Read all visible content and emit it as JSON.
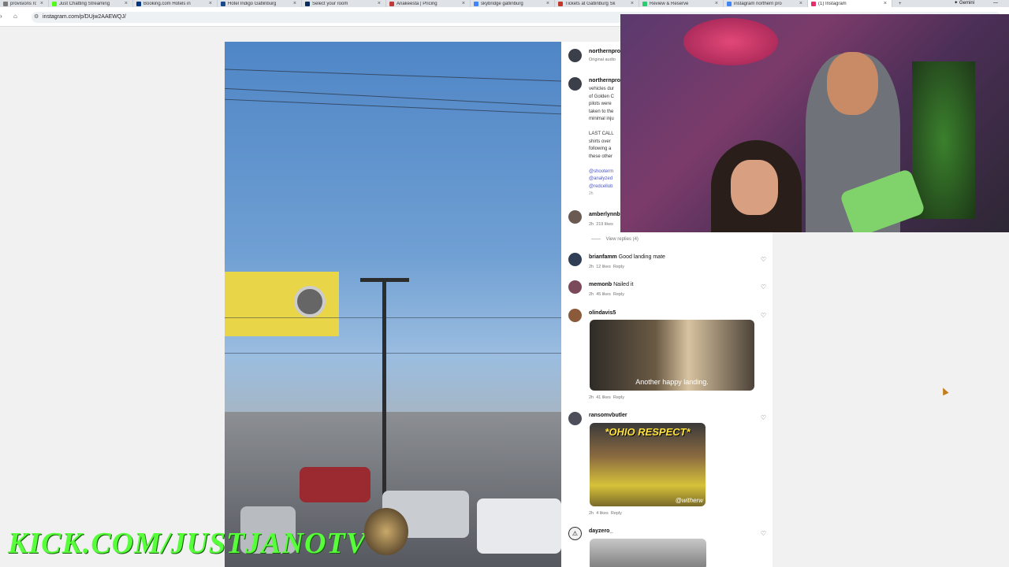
{
  "browser": {
    "tabs": [
      {
        "label": "provisions robi",
        "color": "#7a7a7a"
      },
      {
        "label": "Just Chatting Streaming",
        "color": "#53fc18"
      },
      {
        "label": "Booking.com Hotels in",
        "color": "#003580"
      },
      {
        "label": "Hotel Indigo Gatlinburg",
        "color": "#1a4a8a"
      },
      {
        "label": "Select your room",
        "color": "#0b2d5c"
      },
      {
        "label": "Anakeesta | Pricing",
        "color": "#c23b3b"
      },
      {
        "label": "skybridge gatlinburg",
        "color": "#4285f4"
      },
      {
        "label": "Tickets at Gatlinburg Sk",
        "color": "#c0392b"
      },
      {
        "label": "Review & Reserve",
        "color": "#2ecc71"
      },
      {
        "label": "instagram northern pro",
        "color": "#4285f4"
      },
      {
        "label": "(1) Instagram",
        "color": "#e1306c",
        "active": true
      }
    ],
    "gemini_label": "Gemini",
    "url": "instagram.com/p/DUjw2AAEWQJ/"
  },
  "post": {
    "header_user": "northernpro",
    "header_sub": "Original audio",
    "caption_user": "northernpro",
    "caption_lines": [
      "vehicles dur",
      "of Golden C",
      "pilots were",
      "taken to the",
      "minimal inju",
      "",
      "LAST CALL",
      "shirts over",
      "following a",
      "these other",
      "",
      "@shooterm",
      "@analyzed",
      "@redcellob",
      "2h"
    ]
  },
  "comments": [
    {
      "user": "amberlynnb",
      "text": "",
      "time": "2h",
      "likes": "219 likes",
      "view_replies": "View replies (4)"
    },
    {
      "user": "brianfamm",
      "text": "Good landing mate",
      "time": "2h",
      "likes": "12 likes",
      "reply": "Reply"
    },
    {
      "user": "memonb",
      "text": "Nailed it",
      "time": "2h",
      "likes": "45 likes",
      "reply": "Reply"
    },
    {
      "user": "olindavis5",
      "text": "",
      "gif_caption": "Another happy landing.",
      "time": "2h",
      "likes": "41 likes",
      "reply": "Reply"
    },
    {
      "user": "ransomvbutler",
      "text": "",
      "gif_caption": "*OHIO RESPECT*",
      "gif_tag": "@witherw",
      "time": "2h",
      "likes": "4 likes",
      "reply": "Reply"
    },
    {
      "user": "dayzero_",
      "text": ""
    }
  ],
  "overlay": {
    "kick_text": "KICK.COM/JUSTJANOTV"
  },
  "colors": {
    "kick_green": "#57ff3b",
    "instagram_link": "#4a55c8"
  }
}
